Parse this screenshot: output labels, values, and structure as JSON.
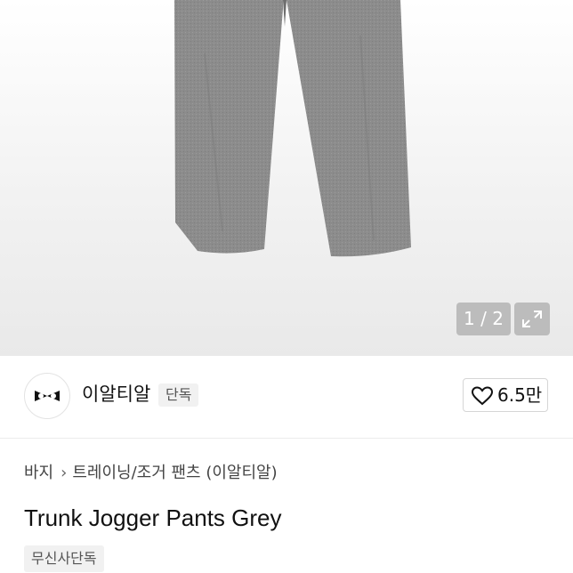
{
  "gallery": {
    "counter": "1 / 2"
  },
  "brand": {
    "name": "이알티알",
    "badge": "단독"
  },
  "like": {
    "count": "6.5만"
  },
  "breadcrumb": {
    "category": "바지",
    "subcategory": "트레이닝/조거 팬츠 (이알티알)"
  },
  "product": {
    "title": "Trunk Jogger Pants Grey",
    "tag": "무신사단독"
  },
  "icons": {
    "expand": "expand-icon",
    "heart": "heart-icon",
    "chevron": "chevron-right-icon",
    "logo": "brand-logo-icon"
  },
  "colors": {
    "pants": "#8f8f8f",
    "badge_bg": "#f1f1f1",
    "text": "#111111"
  }
}
